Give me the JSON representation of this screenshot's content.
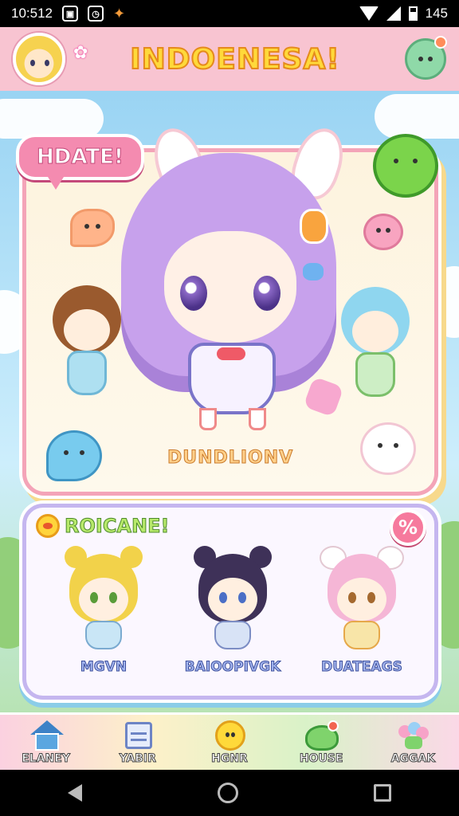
{
  "status_bar": {
    "time": "10:512",
    "icons": [
      "image-icon",
      "clock-icon",
      "game-icon"
    ],
    "battery_text": "145"
  },
  "header": {
    "title": "INDOENESA!",
    "avatar_icon": "avatar-portrait",
    "pet_icon": "green-pet-icon"
  },
  "hero": {
    "badge": "HDATE!",
    "label": "DUNDLIONV"
  },
  "roster": {
    "title": "ROICANE!",
    "discount_symbol": "%",
    "items": [
      {
        "name": "MGVN",
        "hair_color": "#f2d24a",
        "ear_color": "#f2d24a",
        "body_color": "#c9e6f6"
      },
      {
        "name": "BAIOOPIVGK",
        "hair_color": "#3e3158",
        "ear_color": "#3e3158",
        "body_color": "#d8e3f6"
      },
      {
        "name": "DUATEAGS",
        "hair_color": "#f5b6d6",
        "ear_color": "#ffffff",
        "body_color": "#f8e5a8"
      }
    ]
  },
  "bottom_nav": [
    {
      "label": "ELANEY",
      "icon": "house-icon"
    },
    {
      "label": "YABIR",
      "icon": "board-icon"
    },
    {
      "label": "HGNR",
      "icon": "smiley-icon"
    },
    {
      "label": "HOUSE",
      "icon": "frog-icon"
    },
    {
      "label": "AGGAK",
      "icon": "bouquet-icon"
    }
  ],
  "colors": {
    "header_bg": "#f8c4d1",
    "title_fill": "#ffd93a",
    "hero_border": "#f4a4b8",
    "roster_border": "#c5b6ef"
  }
}
